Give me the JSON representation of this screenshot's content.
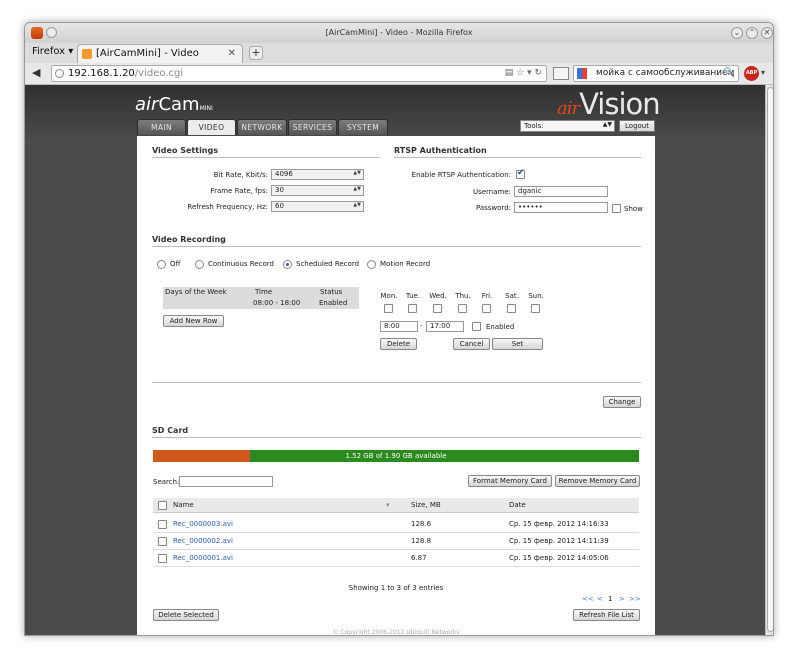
{
  "window": {
    "title": "[AirCamMini] - Video - Mozilla Firefox"
  },
  "menubar": {
    "firefox": "Firefox ▾",
    "tab_label": "[AirCamMini] - Video",
    "close_tab": "✕",
    "new_tab": "+"
  },
  "navbar": {
    "url_host": "192.168.1.20",
    "url_path": "/video.cgi",
    "search_value": "мойка с самообслуживанием"
  },
  "header": {
    "logo_air": "air",
    "logo_cam": "Cam",
    "logo_mini": "MINI",
    "brand_air": "air",
    "brand_vision": "Vision",
    "tools_value": "Tools:",
    "logout": "Logout"
  },
  "nav_tabs": [
    {
      "label": "MAIN",
      "active": false
    },
    {
      "label": "VIDEO",
      "active": true
    },
    {
      "label": "NETWORK",
      "active": false
    },
    {
      "label": "SERVICES",
      "active": false
    },
    {
      "label": "SYSTEM",
      "active": false
    }
  ],
  "video_settings": {
    "title": "Video Settings",
    "bitrate_label": "Bit Rate, Kbit/s:",
    "bitrate_value": "4096",
    "framerate_label": "Frame Rate, fps:",
    "framerate_value": "30",
    "refresh_label": "Refresh Frequency, Hz:",
    "refresh_value": "60"
  },
  "rtsp": {
    "title": "RTSP Authentication",
    "enable_label": "Enable RTSP Authentication:",
    "enabled": true,
    "username_label": "Username:",
    "username_value": "dganic",
    "password_label": "Password:",
    "password_value": "••••••",
    "show_label": "Show"
  },
  "recording": {
    "title": "Video Recording",
    "modes": [
      {
        "label": "Off",
        "selected": false
      },
      {
        "label": "Continuous Record",
        "selected": false
      },
      {
        "label": "Scheduled Record",
        "selected": true
      },
      {
        "label": "Motion Record",
        "selected": false
      }
    ],
    "schedule_headers": {
      "days": "Days of the Week",
      "time": "Time",
      "status": "Status"
    },
    "schedule_rows": [
      {
        "days": "",
        "time": "08:00 - 18:00",
        "status": "Enabled"
      }
    ],
    "add_row": "Add New Row",
    "days": [
      "Mon.",
      "Tue.",
      "Wed.",
      "Thu.",
      "Fri.",
      "Sat.",
      "Sun."
    ],
    "time_from": "8:00",
    "time_sep": "-",
    "time_to": "17:00",
    "enabled_label": "Enabled",
    "delete": "Delete",
    "cancel": "Cancel",
    "set": "Set",
    "change": "Change"
  },
  "sd_card": {
    "title": "SD Card",
    "used_fraction": 0.2,
    "storage_text": "1.52 GB of 1.90 GB available",
    "search_label": "Search:",
    "format": "Format Memory Card",
    "remove": "Remove Memory Card",
    "headers": {
      "name": "Name",
      "sort": "▾",
      "size": "Size, MB",
      "date": "Date"
    },
    "files": [
      {
        "name": "Rec_0000003.avi",
        "size": "128.6",
        "date": "Ср. 15 февр. 2012 14:16:33"
      },
      {
        "name": "Rec_0000002.avi",
        "size": "128.8",
        "date": "Ср. 15 февр. 2012 14:11:39"
      },
      {
        "name": "Rec_0000001.avi",
        "size": "6.87",
        "date": "Ср. 15 февр. 2012 14:05:06"
      }
    ],
    "showing": "Showing 1 to 3 of 3 entries",
    "pager": {
      "first": "<<",
      "prev": "<",
      "page": "1",
      "next": ">",
      "last": ">>"
    },
    "delete_selected": "Delete Selected",
    "refresh": "Refresh File List"
  },
  "footer": {
    "copyright": "© Copyright 2006-2012 Ubiquiti Networks"
  }
}
